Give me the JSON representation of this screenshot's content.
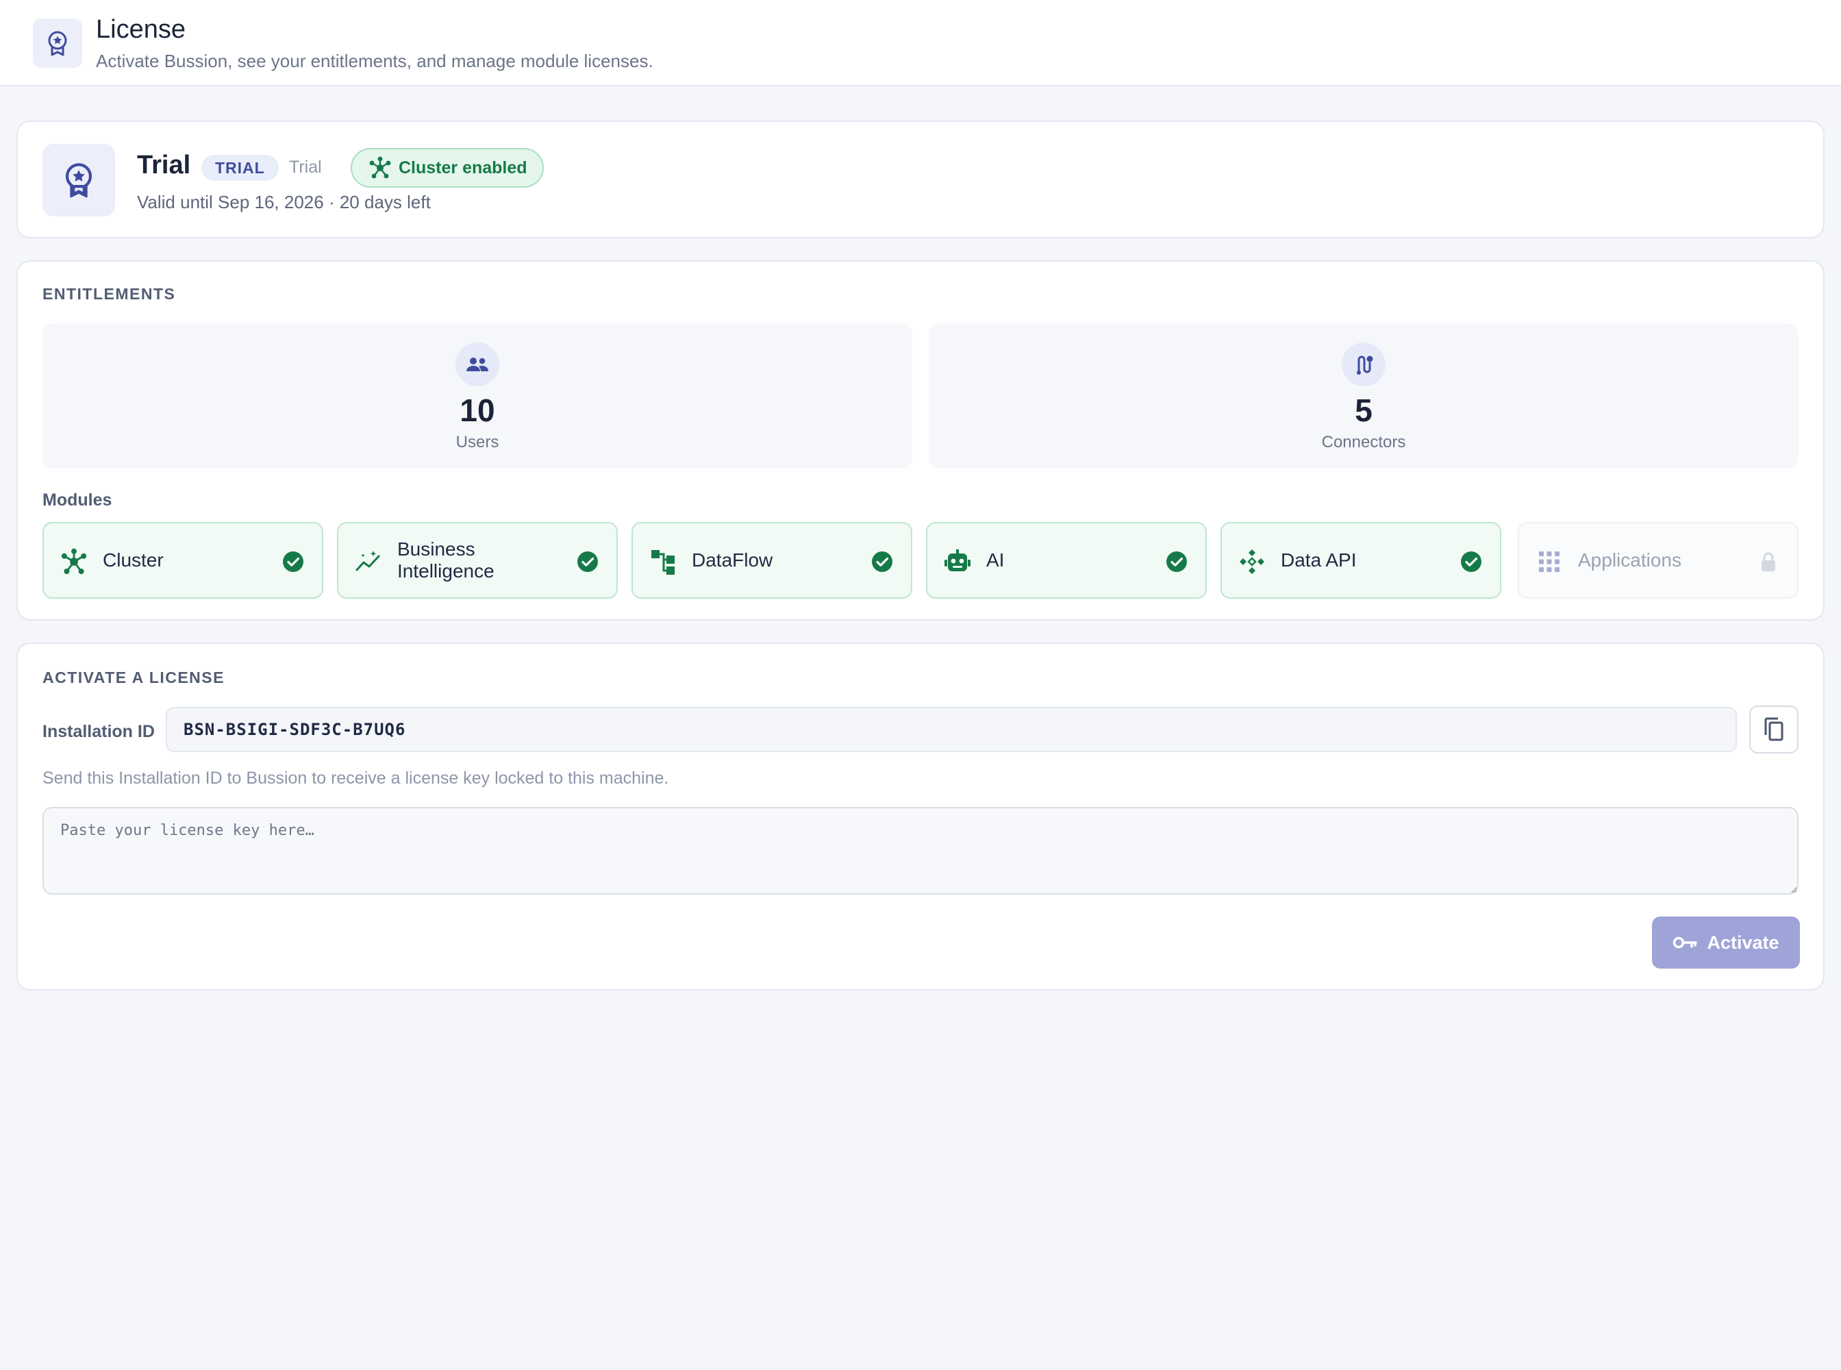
{
  "header": {
    "title": "License",
    "subtitle": "Activate Bussion, see your entitlements, and manage module licenses.",
    "icon": "award-icon"
  },
  "status": {
    "plan_name": "Trial",
    "badge": "TRIAL",
    "plan_type": "Trial",
    "cluster_pill": "Cluster enabled",
    "validity": "Valid until Sep 16, 2026 · 20 days left"
  },
  "entitlements": {
    "section_label": "ENTITLEMENTS",
    "tiles": [
      {
        "value": "10",
        "label": "Users",
        "icon": "users-icon"
      },
      {
        "value": "5",
        "label": "Connectors",
        "icon": "route-icon"
      }
    ],
    "modules_label": "Modules",
    "modules": [
      {
        "name": "Cluster",
        "icon": "hub-icon",
        "state": "enabled"
      },
      {
        "name": "Business Intelligence",
        "icon": "insights-icon",
        "state": "enabled"
      },
      {
        "name": "DataFlow",
        "icon": "flow-icon",
        "state": "enabled"
      },
      {
        "name": "AI",
        "icon": "robot-icon",
        "state": "enabled"
      },
      {
        "name": "Data API",
        "icon": "api-icon",
        "state": "enabled"
      },
      {
        "name": "Applications",
        "icon": "apps-grid-icon",
        "state": "locked"
      }
    ]
  },
  "activate": {
    "section_label": "ACTIVATE A LICENSE",
    "installation_label": "Installation ID",
    "installation_id": "BSN-BSIGI-SDF3C-B7UQ6",
    "hint": "Send this Installation ID to Bussion to receive a license key locked to this machine.",
    "key_placeholder": "Paste your license key here…",
    "activate_label": "Activate"
  },
  "colors": {
    "accent": "#3f4c9e",
    "success": "#167a48",
    "button_disabled": "#9ea4d8"
  }
}
